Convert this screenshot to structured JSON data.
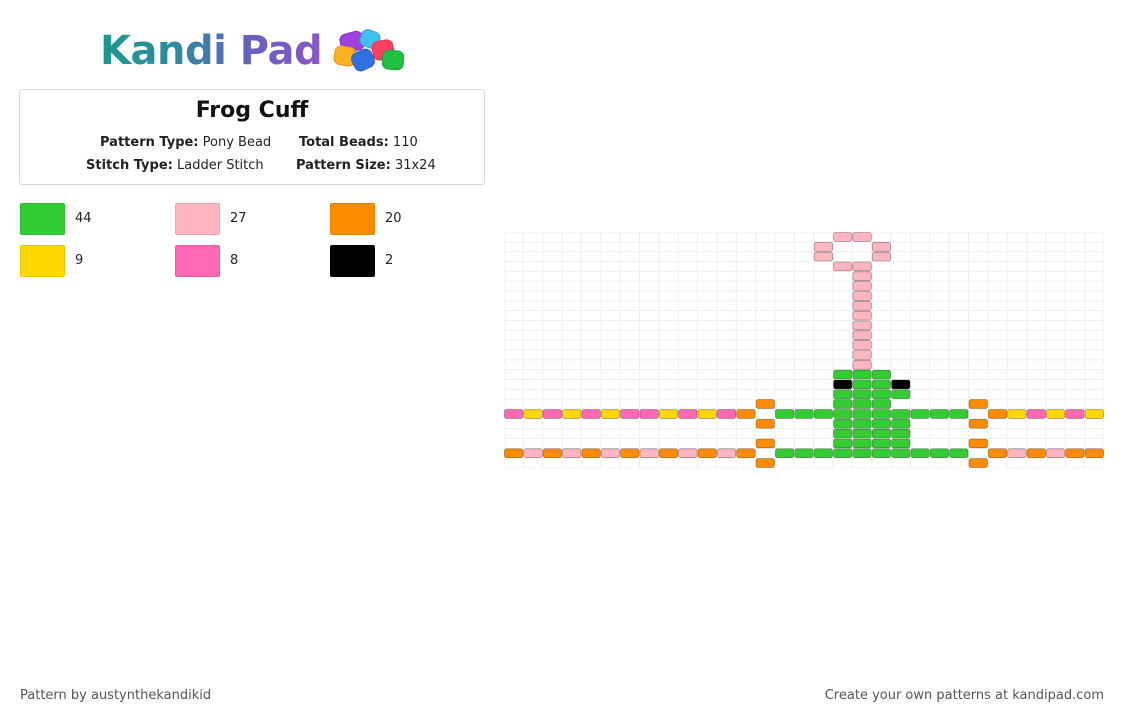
{
  "brand": {
    "name": "Kandi Pad",
    "bead_colors": [
      "#a040e0",
      "#40c0f0",
      "#ff4060",
      "#ffb020",
      "#20c040",
      "#3070e0"
    ]
  },
  "pattern": {
    "title": "Frog Cuff",
    "type_label": "Pattern Type:",
    "type_value": "Pony Bead",
    "total_label": "Total Beads:",
    "total_value": "110",
    "stitch_label": "Stitch Type:",
    "stitch_value": "Ladder Stitch",
    "size_label": "Pattern Size:",
    "size_value": "31x24"
  },
  "palette": [
    {
      "color": "#33cc33",
      "count": "44"
    },
    {
      "color": "#ffb6c1",
      "count": "27"
    },
    {
      "color": "#ff8c00",
      "count": "20"
    },
    {
      "color": "#ffd700",
      "count": "9"
    },
    {
      "color": "#ff69b4",
      "count": "8"
    },
    {
      "color": "#000000",
      "count": "2"
    }
  ],
  "grid": {
    "columns": 31,
    "rows": 24,
    "legend": {
      "G": "#33cc33",
      "P": "#ffb6c1",
      "O": "#ff8c00",
      "Y": "#ffd700",
      "H": "#ff69b4",
      "K": "#000000"
    },
    "beads": [
      "...............................",
      "...............................",
      "...............................",
      "...............................",
      "...............................",
      "...............................",
      "...............................",
      "...............................",
      "...............................",
      "...............................",
      "...............................",
      "...............................",
      "...............................",
      "...............................",
      "...............................",
      "...............................",
      "...............................",
      "...............................",
      "...............................",
      "...............................",
      "...............................",
      "...............................",
      "...............................",
      "..............................."
    ]
  },
  "footer": {
    "credit": "Pattern by austynthekandikid",
    "promo": "Create your own patterns at kandipad.com"
  }
}
